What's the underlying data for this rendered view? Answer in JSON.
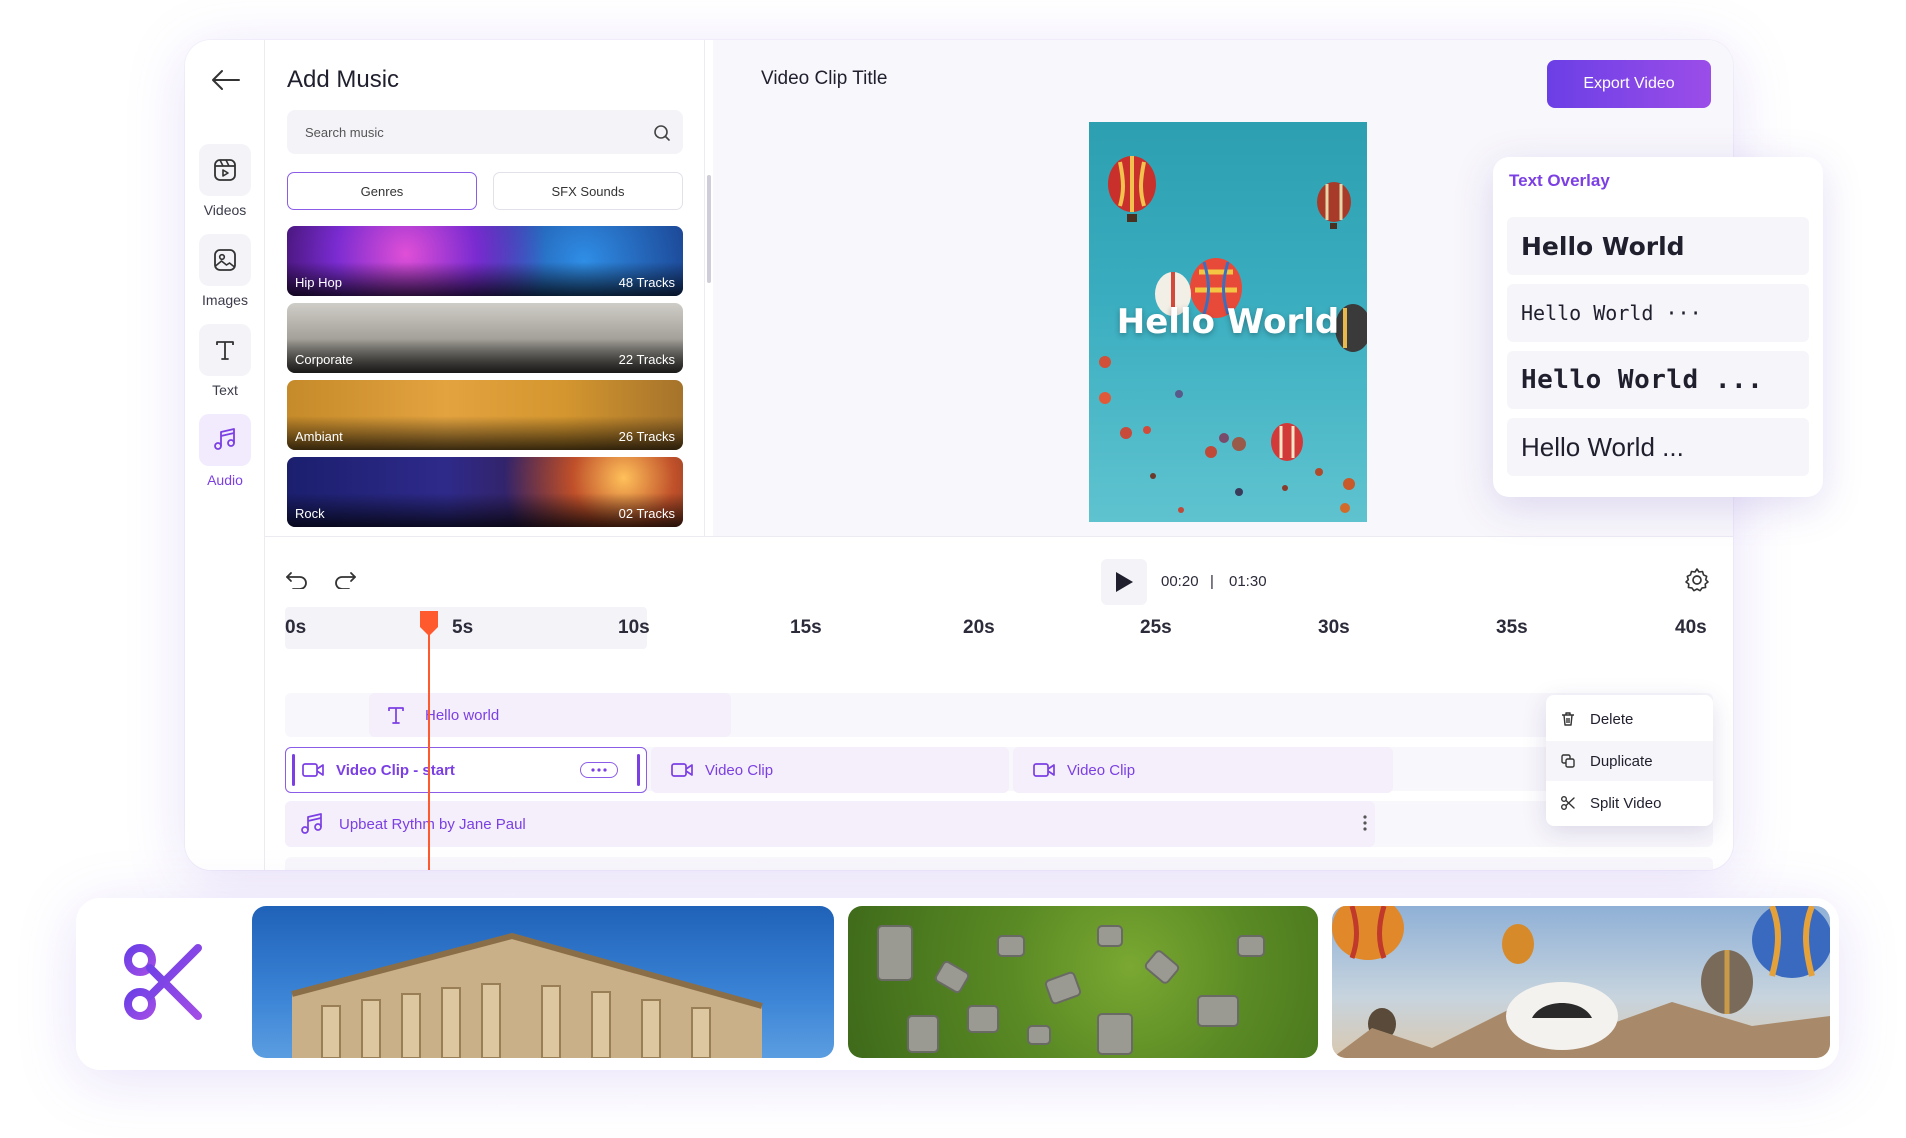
{
  "sidebar": {
    "back_label": "",
    "items": [
      {
        "label": "Videos",
        "icon": "video-icon"
      },
      {
        "label": "Images",
        "icon": "image-icon"
      },
      {
        "label": "Text",
        "icon": "text-icon"
      },
      {
        "label": "Audio",
        "icon": "music-icon",
        "active": true
      }
    ]
  },
  "music_panel": {
    "title": "Add Music",
    "search_placeholder": "Search music",
    "tabs": [
      {
        "label": "Genres",
        "active": true
      },
      {
        "label": "SFX Sounds"
      }
    ],
    "genres": [
      {
        "name": "Hip Hop",
        "count": "48 Tracks"
      },
      {
        "name": "Corporate",
        "count": "22 Tracks"
      },
      {
        "name": "Ambiant",
        "count": "26 Tracks"
      },
      {
        "name": "Rock",
        "count": "02 Tracks"
      }
    ]
  },
  "preview": {
    "clip_title": "Video Clip Title",
    "export_label": "Export Video",
    "overlay_text": "Hello World"
  },
  "text_overlay": {
    "title": "Text Overlay",
    "styles": [
      "Hello World",
      "Hello World ···",
      "Hello World ...",
      "Hello World ..."
    ]
  },
  "timeline": {
    "current_time": "00:20",
    "separator": "|",
    "total_time": "01:30",
    "ticks": [
      "0s",
      "5s",
      "10s",
      "15s",
      "20s",
      "25s",
      "30s",
      "35s",
      "40s"
    ],
    "playhead_seconds": 4.4,
    "text_track": {
      "label": "Hello world"
    },
    "video_tracks": [
      {
        "label": "Video Clip - start",
        "selected": true
      },
      {
        "label": "Video Clip"
      },
      {
        "label": "Video Clip"
      }
    ],
    "audio_track": {
      "label": "Upbeat Rythm by Jane Paul"
    }
  },
  "context_menu": {
    "items": [
      {
        "label": "Delete",
        "icon": "trash-icon"
      },
      {
        "label": "Duplicate",
        "icon": "duplicate-icon"
      },
      {
        "label": "Split Video",
        "icon": "scissors-icon"
      }
    ]
  },
  "colors": {
    "accent": "#7b3fe4",
    "playhead": "#ff5a2e",
    "track_bg": "#f4effb"
  }
}
